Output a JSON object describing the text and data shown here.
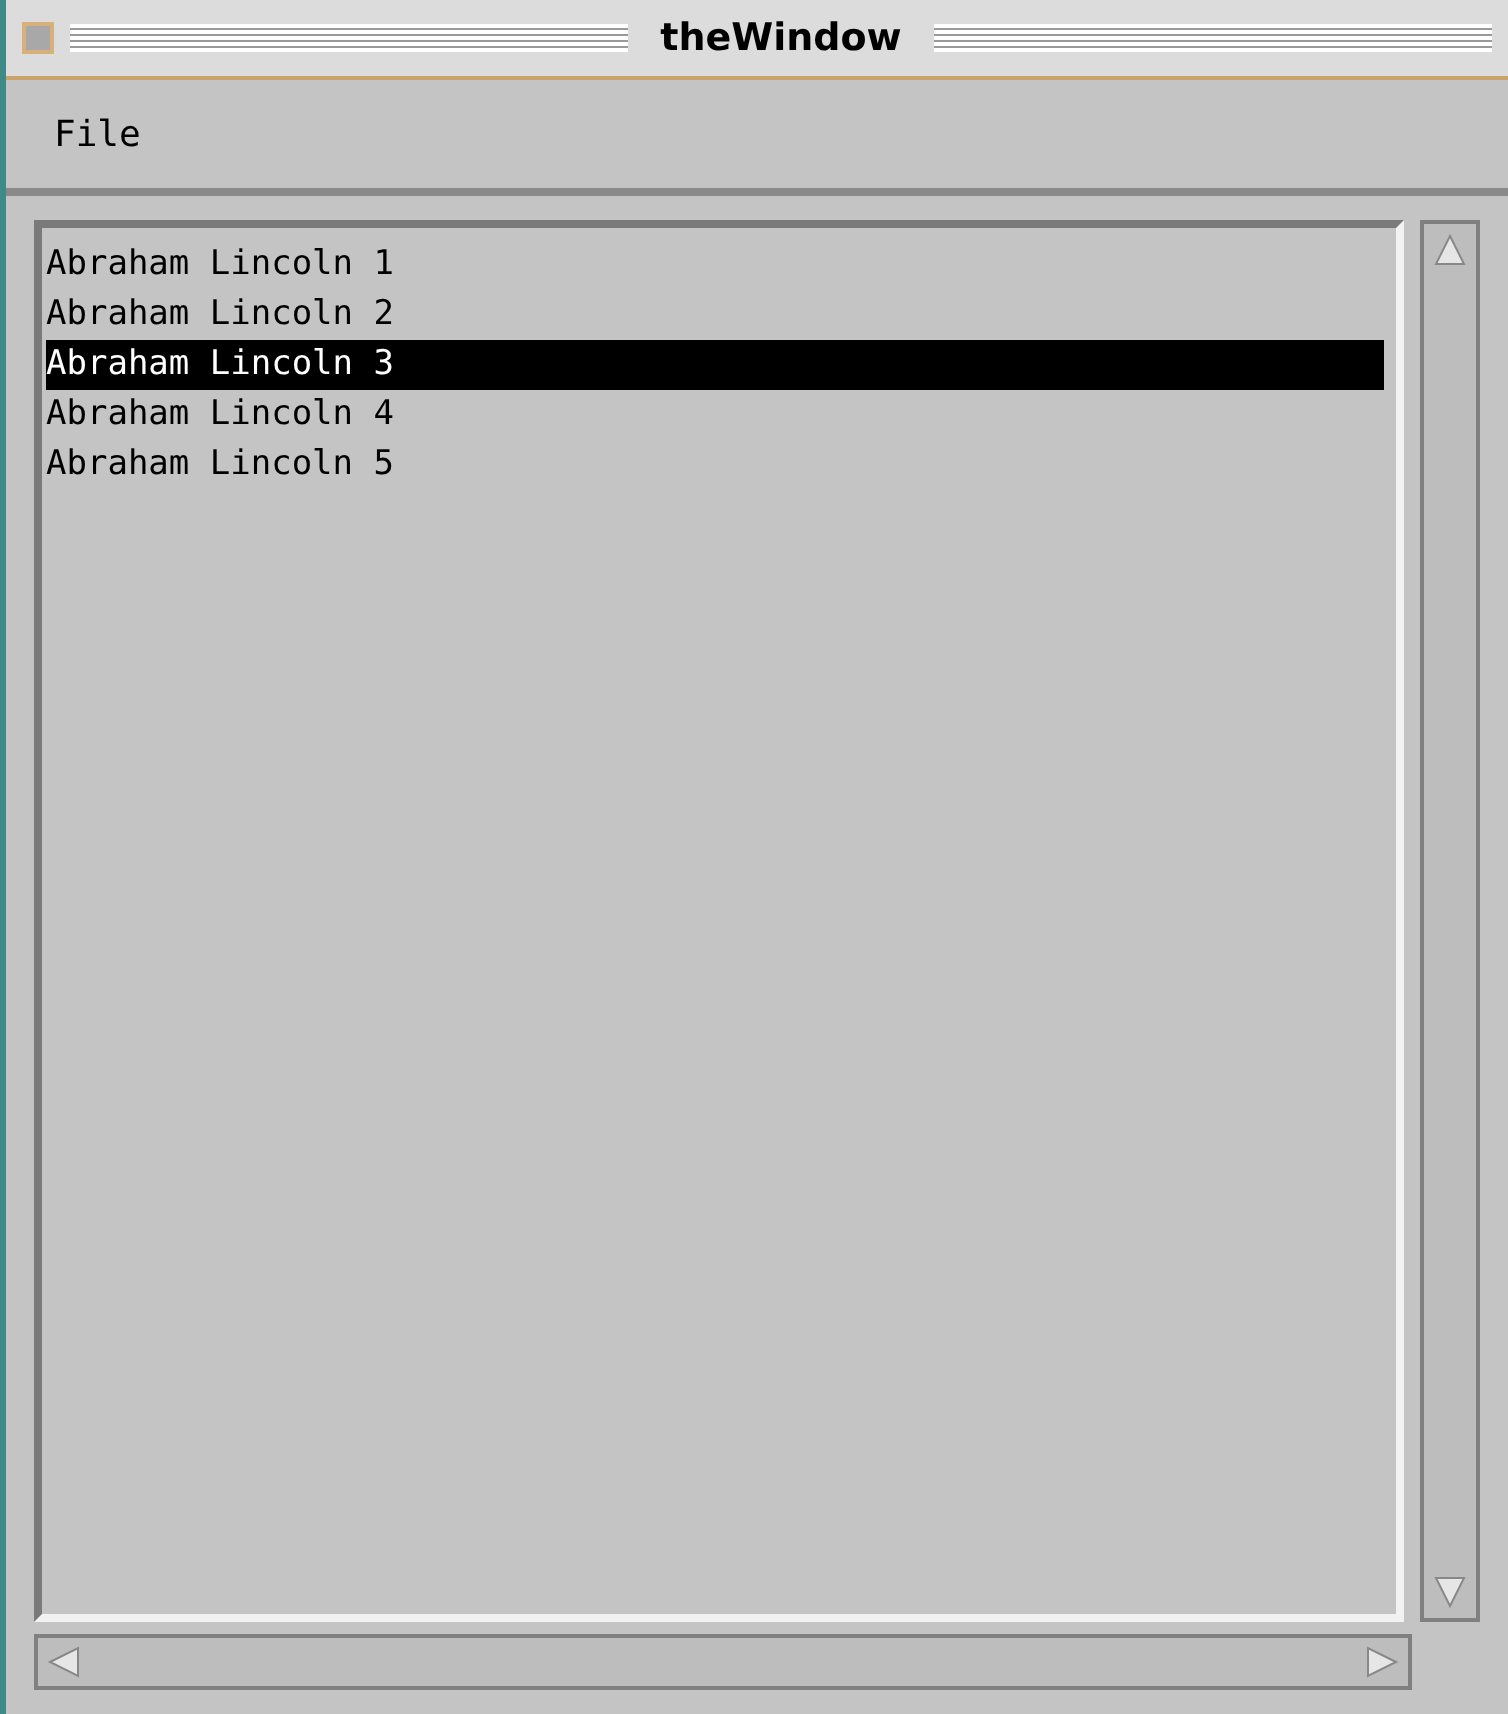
{
  "window": {
    "title": "theWindow"
  },
  "menu": [
    {
      "label": "File"
    }
  ],
  "list": {
    "items": [
      {
        "label": "Abraham Lincoln 1",
        "selected": false
      },
      {
        "label": "Abraham Lincoln 2",
        "selected": false
      },
      {
        "label": "Abraham Lincoln 3",
        "selected": true
      },
      {
        "label": "Abraham Lincoln 4",
        "selected": false
      },
      {
        "label": "Abraham Lincoln 5",
        "selected": false
      }
    ]
  }
}
